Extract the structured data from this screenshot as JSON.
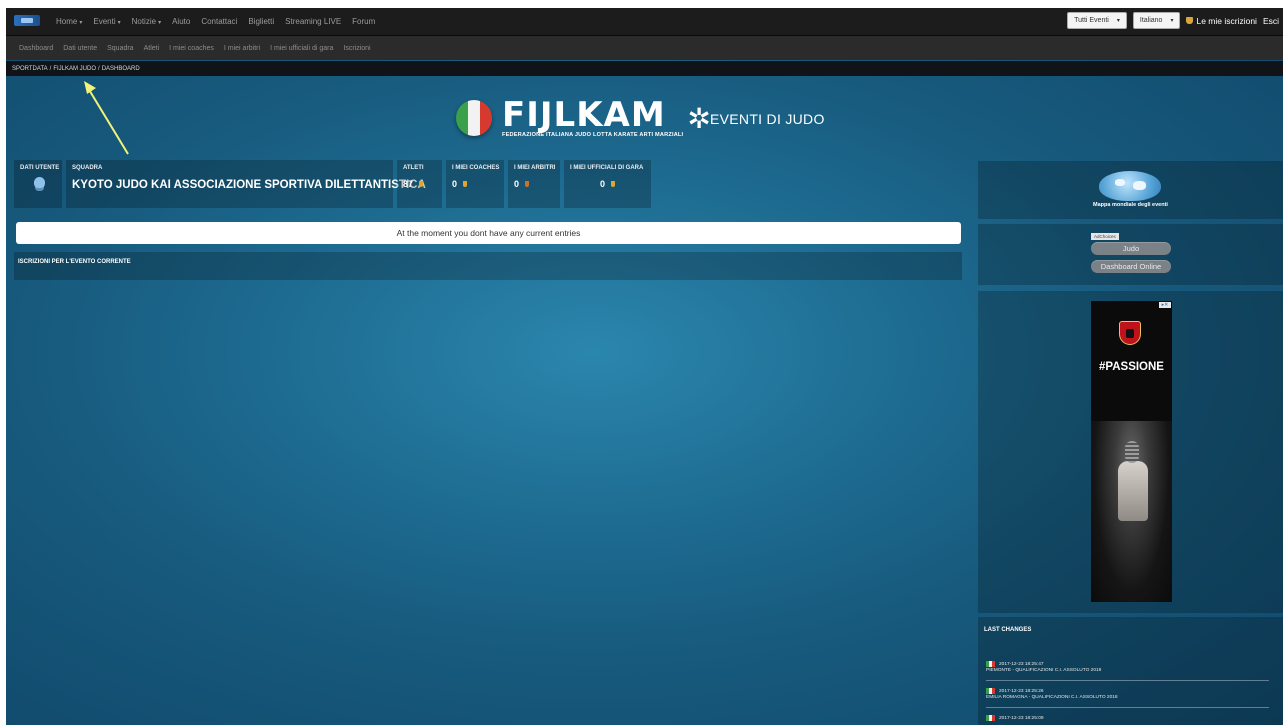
{
  "topnav": {
    "items": [
      {
        "label": "Home",
        "dropdown": true
      },
      {
        "label": "Eventi",
        "dropdown": true
      },
      {
        "label": "Notizie",
        "dropdown": true
      },
      {
        "label": "Aiuto",
        "dropdown": false
      },
      {
        "label": "Contattaci",
        "dropdown": false
      },
      {
        "label": "Biglietti",
        "dropdown": false
      },
      {
        "label": "Streaming LIVE",
        "dropdown": false
      },
      {
        "label": "Forum",
        "dropdown": false
      }
    ],
    "events_select": "Tutti Eventi",
    "language_select": "Italiano",
    "my_entries": "Le mie iscrizioni",
    "logout": "Esci"
  },
  "subnav": {
    "items": [
      "Dashboard",
      "Dati utente",
      "Squadra",
      "Atleti",
      "I miei coaches",
      "I miei arbitri",
      "I miei ufficiali di gara",
      "Iscrizioni"
    ]
  },
  "breadcrumb": [
    "SPORTDATA",
    "FIJLKAM JUDO",
    "DASHBOARD"
  ],
  "brand": {
    "word": "FIJLKAM",
    "subtitle": "FEDERAZIONE ITALIANA JUDO LOTTA KARATE ARTI MARZIALI",
    "event_title": "EVENTI DI JUDO"
  },
  "stats": {
    "user_label": "DATI UTENTE",
    "team_label": "SQUADRA",
    "team_name": "KYOTO JUDO KAI ASSOCIAZIONE SPORTIVA DILETTANTISTICA",
    "athletes_label": "ATLETI",
    "athletes_value": "87",
    "coaches_label": "I MIEI COACHES",
    "coaches_value": "0",
    "referees_label": "I MIEI ARBITRI",
    "referees_value": "0",
    "officials_label": "I MIEI UFFICIALI DI GARA",
    "officials_value": "0"
  },
  "main": {
    "message": "At the moment you dont have any current entries",
    "current_event_title": "ISCRIZIONI PER L'EVENTO CORRENTE"
  },
  "sidebar": {
    "map_caption": "Mappa mondiale degli eventi",
    "adchoices": "AdChoices",
    "buttons": [
      "Judo",
      "Dashboard Online"
    ],
    "ad_text": "#PASSIONE",
    "last_changes_title": "LAST CHANGES",
    "changes": [
      {
        "date": "2017-12-23 18:25:47",
        "title": "PIEMONTE - QUALIFICAZIONI C.I. ASSOLUTO 2018"
      },
      {
        "date": "2017-12-23 18:25:26",
        "title": "EMILIA ROMAGNA - QUALIFICAZIONI C.I. ASSOLUTO 2018"
      },
      {
        "date": "2017-12-23 18:25:09",
        "title": ""
      }
    ]
  },
  "colors": {
    "background": "#1e6c92",
    "navbar": "#1c1c1c",
    "subnav": "#2b2b2b",
    "annotation_arrow": "#f2f27a"
  }
}
